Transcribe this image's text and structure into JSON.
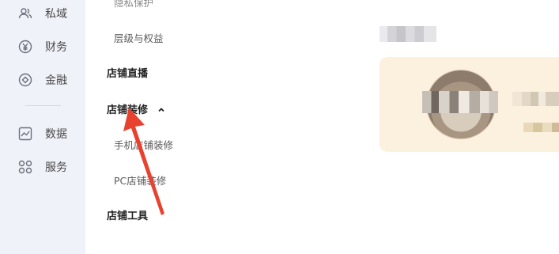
{
  "sidebar": {
    "items": [
      {
        "label": "私域",
        "icon": "users-icon"
      },
      {
        "label": "财务",
        "icon": "yuan-circle-icon"
      },
      {
        "label": "金融",
        "icon": "finance-circle-icon"
      },
      {
        "label": "数据",
        "icon": "chart-icon"
      },
      {
        "label": "服务",
        "icon": "apps-grid-icon"
      }
    ]
  },
  "menu": {
    "partial_top": "隐私保护",
    "level_rights": "层级与权益",
    "store_live": "店铺直播",
    "store_decoration": "店铺装修",
    "mobile_decoration": "手机店铺装修",
    "pc_decoration": "PC店铺装修",
    "store_tools": "店铺工具"
  },
  "colors": {
    "rail_bg": "#f0f2f9",
    "card_bg": "#fcf0df",
    "arrow_red": "#e8412f"
  }
}
